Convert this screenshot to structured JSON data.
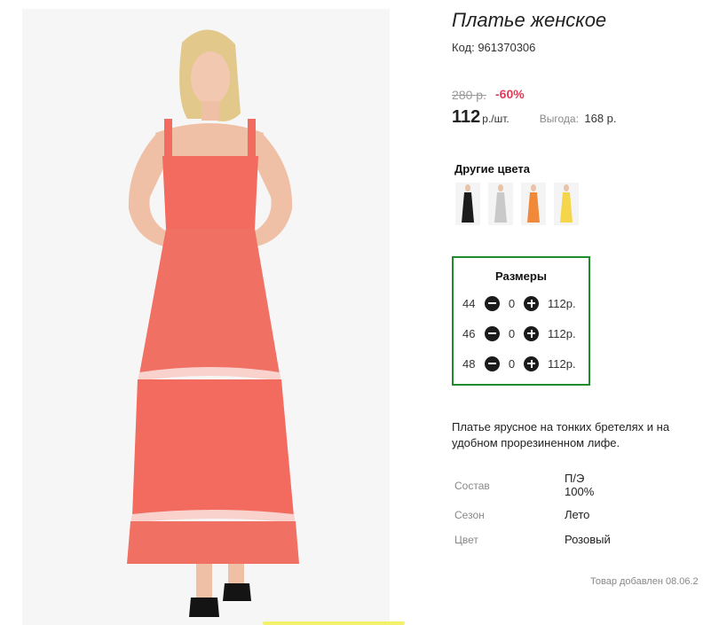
{
  "product": {
    "title": "Платье женское",
    "code_text": "Код: 961370306",
    "old_price": "280 р.",
    "discount": "-60%",
    "price": "112",
    "price_unit": "р./шт.",
    "savings_label": "Выгода:",
    "savings_value": "168 р."
  },
  "other_colors": {
    "title": "Другие цвета",
    "items": [
      {
        "color": "#1c1c1c",
        "label": "black"
      },
      {
        "color": "#c9c9c9",
        "label": "grey"
      },
      {
        "color": "#f08a3a",
        "label": "orange"
      },
      {
        "color": "#f5d54a",
        "label": "yellow"
      }
    ]
  },
  "sizes": {
    "title": "Размеры",
    "rows": [
      {
        "size": "44",
        "qty": "0",
        "price": "112р."
      },
      {
        "size": "46",
        "qty": "0",
        "price": "112р."
      },
      {
        "size": "48",
        "qty": "0",
        "price": "112р."
      }
    ]
  },
  "description": "Платье ярусное на тонких бретелях и на удобном прорезиненном лифе.",
  "attributes": [
    {
      "key": "Состав",
      "value": "П/Э\n100%"
    },
    {
      "key": "Сезон",
      "value": "Лето"
    },
    {
      "key": "Цвет",
      "value": "Розовый"
    }
  ],
  "added_text": "Товар добавлен 08.06.2",
  "colors": {
    "dress": "#f26b5e",
    "accent_green": "#1e8c2a",
    "discount_red": "#e23a5a"
  }
}
